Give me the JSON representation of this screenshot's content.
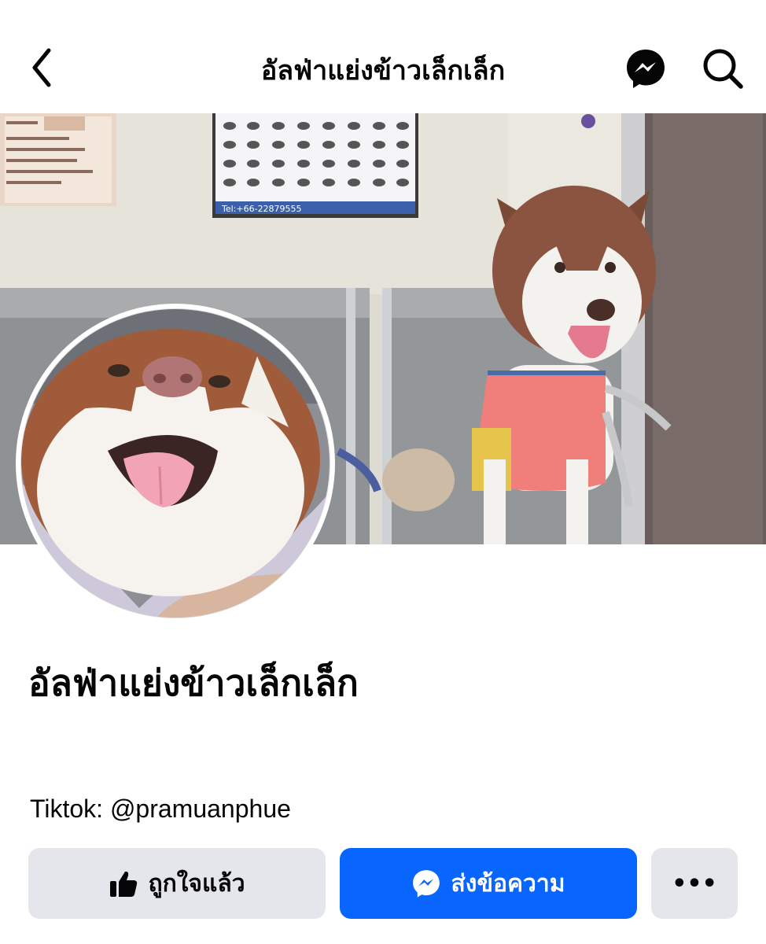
{
  "header": {
    "title": "อัลฟ่าแย่งข้าวเล็กเล็ก",
    "back_icon": "chevron-left-icon",
    "messenger_icon": "messenger-icon",
    "search_icon": "search-icon"
  },
  "cover": {
    "poster_phone": "Tel:+66-22879555"
  },
  "profile": {
    "name": "อัลฟ่าแย่งข้าวเล็กเล็ก",
    "bio": "Tiktok: @pramuanphue"
  },
  "actions": {
    "like_label": "ถูกใจแล้ว",
    "like_icon": "thumbs-up-icon",
    "message_label": "ส่งข้อความ",
    "message_icon": "messenger-icon",
    "more_label": "•••"
  },
  "colors": {
    "accent": "#0866ff",
    "button_gray": "#e4e6eb",
    "text": "#050505"
  }
}
